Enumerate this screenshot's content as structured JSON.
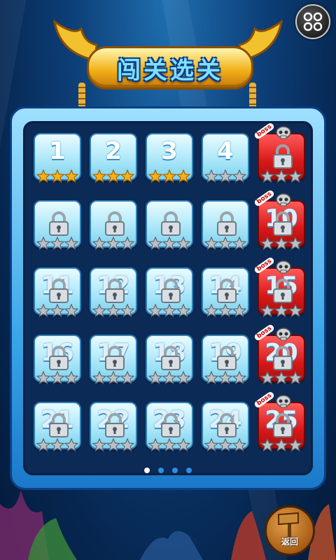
{
  "title": "闯关选关",
  "menu_button": {
    "icon": "grid-menu-icon"
  },
  "back_button": {
    "label": "返回",
    "icon": "signpost-icon"
  },
  "page_indicator": {
    "count": 4,
    "active": 0
  },
  "colors": {
    "gold_star": "#f2b21b",
    "grey_star": "#b9c1c8",
    "boss": "#d91818",
    "tile": "#b8ecfb"
  },
  "levels": [
    {
      "num": "1",
      "locked": false,
      "boss": false,
      "stars": 3
    },
    {
      "num": "2",
      "locked": false,
      "boss": false,
      "stars": 3
    },
    {
      "num": "3",
      "locked": false,
      "boss": false,
      "stars": 3
    },
    {
      "num": "4",
      "locked": false,
      "boss": false,
      "stars": 0
    },
    {
      "num": "",
      "locked": true,
      "boss": true,
      "stars": 0,
      "tag": "boss"
    },
    {
      "num": "",
      "locked": true,
      "boss": false,
      "stars": 0
    },
    {
      "num": "",
      "locked": true,
      "boss": false,
      "stars": 0
    },
    {
      "num": "",
      "locked": true,
      "boss": false,
      "stars": 0
    },
    {
      "num": "",
      "locked": true,
      "boss": false,
      "stars": 0
    },
    {
      "num": "10",
      "locked": true,
      "boss": true,
      "stars": 0,
      "tag": "boss"
    },
    {
      "num": "11",
      "locked": true,
      "boss": false,
      "stars": 0
    },
    {
      "num": "12",
      "locked": true,
      "boss": false,
      "stars": 0
    },
    {
      "num": "13",
      "locked": true,
      "boss": false,
      "stars": 0
    },
    {
      "num": "14",
      "locked": true,
      "boss": false,
      "stars": 0
    },
    {
      "num": "15",
      "locked": true,
      "boss": true,
      "stars": 0,
      "tag": "boss"
    },
    {
      "num": "16",
      "locked": true,
      "boss": false,
      "stars": 0
    },
    {
      "num": "17",
      "locked": true,
      "boss": false,
      "stars": 0
    },
    {
      "num": "18",
      "locked": true,
      "boss": false,
      "stars": 0
    },
    {
      "num": "19",
      "locked": true,
      "boss": false,
      "stars": 0
    },
    {
      "num": "20",
      "locked": true,
      "boss": true,
      "stars": 0,
      "tag": "boss"
    },
    {
      "num": "21",
      "locked": true,
      "boss": false,
      "stars": 0
    },
    {
      "num": "22",
      "locked": true,
      "boss": false,
      "stars": 0
    },
    {
      "num": "23",
      "locked": true,
      "boss": false,
      "stars": 0
    },
    {
      "num": "24",
      "locked": true,
      "boss": false,
      "stars": 0
    },
    {
      "num": "25",
      "locked": true,
      "boss": true,
      "stars": 0,
      "tag": "boss"
    }
  ]
}
